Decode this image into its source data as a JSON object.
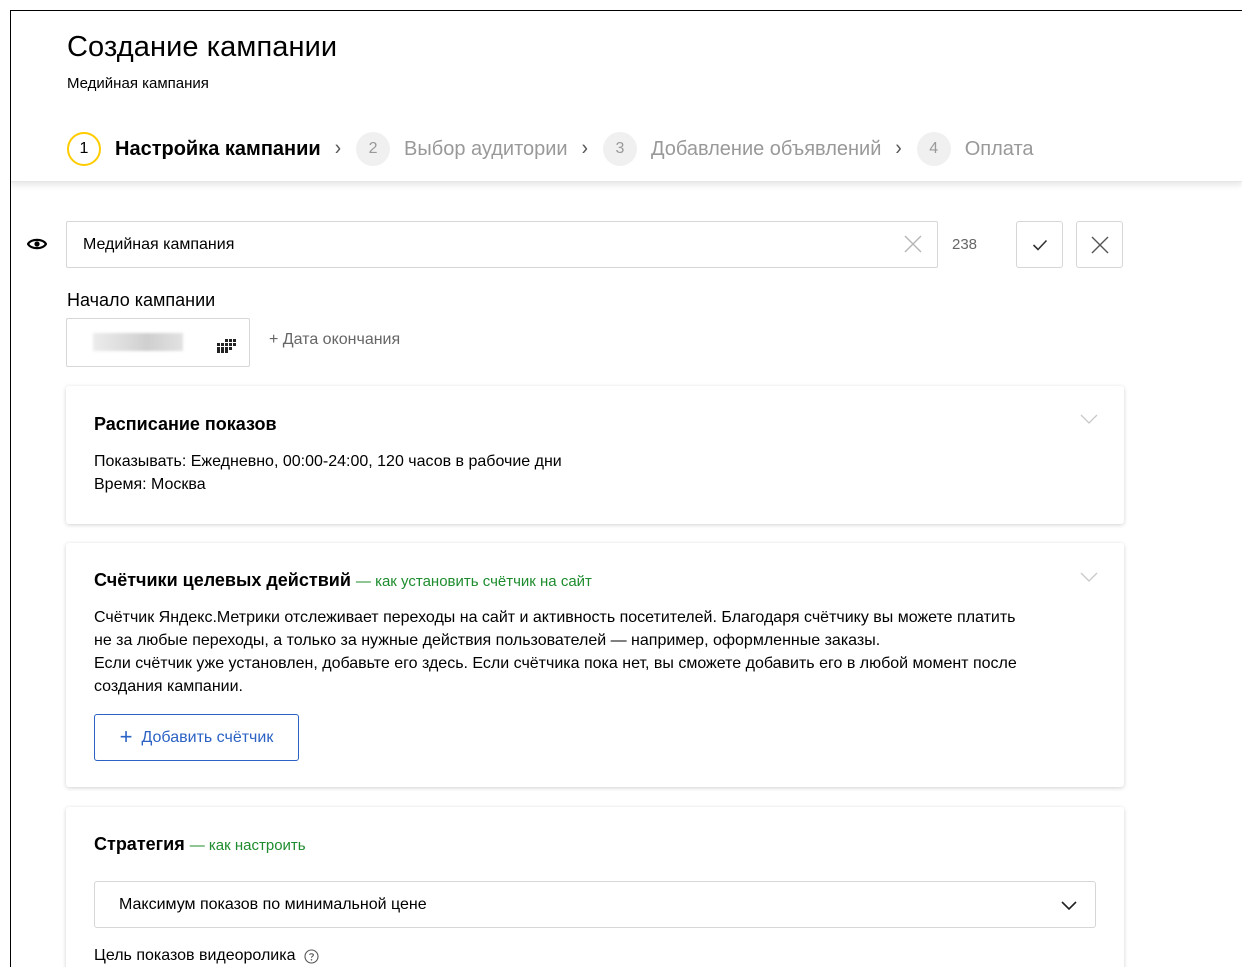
{
  "header": {
    "title": "Создание кампании",
    "subtitle": "Медийная кампания",
    "steps": [
      {
        "num": "1",
        "label": "Настройка кампании",
        "active": true
      },
      {
        "num": "2",
        "label": "Выбор аудитории",
        "active": false
      },
      {
        "num": "3",
        "label": "Добавление объявлений",
        "active": false
      },
      {
        "num": "4",
        "label": "Оплата",
        "active": false
      }
    ]
  },
  "name_field": {
    "value": "Медийная кампания",
    "char_count": "238"
  },
  "start": {
    "label": "Начало кампании",
    "end_date_link": "+ Дата окончания"
  },
  "schedule": {
    "title": "Расписание показов",
    "show_line": "Показывать: Ежедневно, 00:00-24:00, 120 часов в рабочие дни",
    "time_line": "Время: Москва"
  },
  "counters": {
    "title": "Счётчики целевых действий",
    "link": "— как установить счётчик на сайт",
    "paragraph1_line1": "Счётчик Яндекс.Метрики отслеживает переходы на сайт и активность посетителей. Благодаря счётчику вы можете платить",
    "paragraph1_line2": "не за любые переходы, а только за нужные действия пользователей — например, оформленные заказы.",
    "paragraph2_line1": "Если счётчик уже установлен, добавьте его здесь. Если счётчика пока нет, вы сможете добавить его в любой момент после",
    "paragraph2_line2": "создания кампании.",
    "add_button": "Добавить счётчик"
  },
  "strategy": {
    "title": "Стратегия",
    "link": "— как настроить",
    "selected": "Максимум показов по минимальной цене",
    "video_goal_label": "Цель показов видеоролика"
  },
  "colors": {
    "accent_yellow": "#ffcc00",
    "link_green": "#1e8c2e",
    "button_blue": "#2b62c4"
  }
}
